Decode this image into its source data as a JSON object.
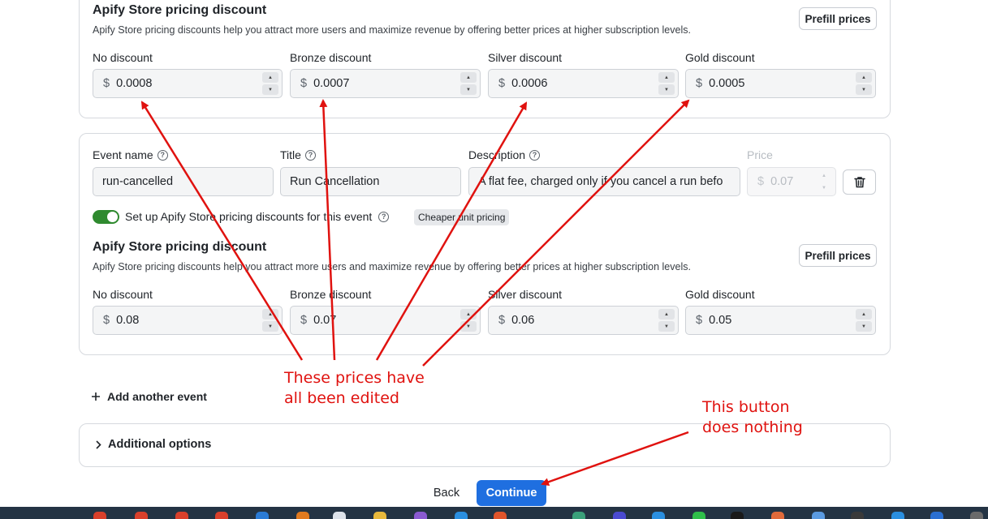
{
  "top_section": {
    "title": "Apify Store pricing discount",
    "description": "Apify Store pricing discounts help you attract more users and maximize revenue by offering better prices at higher subscription levels.",
    "prefill_label": "Prefill prices",
    "currency": "$",
    "tiers": [
      {
        "label": "No discount",
        "value": "0.0008"
      },
      {
        "label": "Bronze discount",
        "value": "0.0007"
      },
      {
        "label": "Silver discount",
        "value": "0.0006"
      },
      {
        "label": "Gold discount",
        "value": "0.0005"
      }
    ]
  },
  "event": {
    "name_label": "Event name",
    "name_value": "run-cancelled",
    "title_label": "Title",
    "title_value": "Run Cancellation",
    "description_label": "Description",
    "description_value": "A flat fee, charged only if you cancel a run befo",
    "price_label": "Price",
    "price_value": "0.07",
    "discount_toggle_label": "Set up Apify Store pricing discounts for this event",
    "discount_toggle_on": true,
    "tag": "Cheaper unit pricing",
    "discount_title": "Apify Store pricing discount",
    "discount_description": "Apify Store pricing discounts help you attract more users and maximize revenue by offering better prices at higher subscription levels.",
    "prefill_label": "Prefill prices",
    "tiers": [
      {
        "label": "No discount",
        "value": "0.08"
      },
      {
        "label": "Bronze discount",
        "value": "0.07"
      },
      {
        "label": "Silver discount",
        "value": "0.06"
      },
      {
        "label": "Gold discount",
        "value": "0.05"
      }
    ]
  },
  "add_event_label": "Add another event",
  "additional_options_label": "Additional options",
  "footer": {
    "back_label": "Back",
    "continue_label": "Continue"
  },
  "annotations": {
    "prices_note_line1": "These prices have",
    "prices_note_line2": "all been edited",
    "button_note_line1": "This button",
    "button_note_line2": "does nothing"
  },
  "colors": {
    "accent": "#1f6fe0",
    "toggle_on": "#2f8a2f",
    "annotation": "#e0120f"
  }
}
